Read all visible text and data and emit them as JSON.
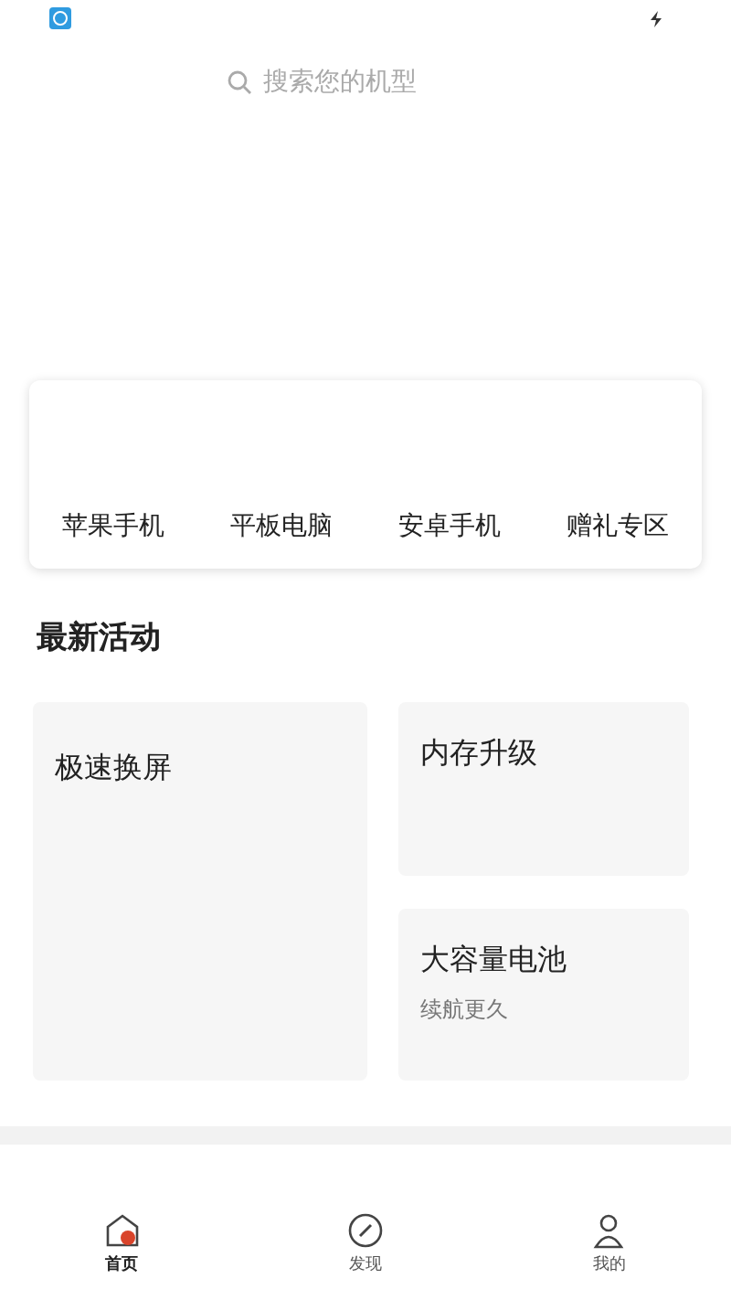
{
  "search": {
    "placeholder": "搜索您的机型"
  },
  "categories": [
    "苹果手机",
    "平板电脑",
    "安卓手机",
    "赠礼专区"
  ],
  "section_title": "最新活动",
  "activities": [
    {
      "title": "极速换屏"
    },
    {
      "title": "内存升级"
    },
    {
      "title": "大容量电池",
      "subtitle": "续航更久"
    }
  ],
  "nav": [
    {
      "label": "首页",
      "kind": "home",
      "selected": true
    },
    {
      "label": "发现",
      "kind": "discover",
      "selected": false
    },
    {
      "label": "我的",
      "kind": "profile",
      "selected": false
    }
  ]
}
